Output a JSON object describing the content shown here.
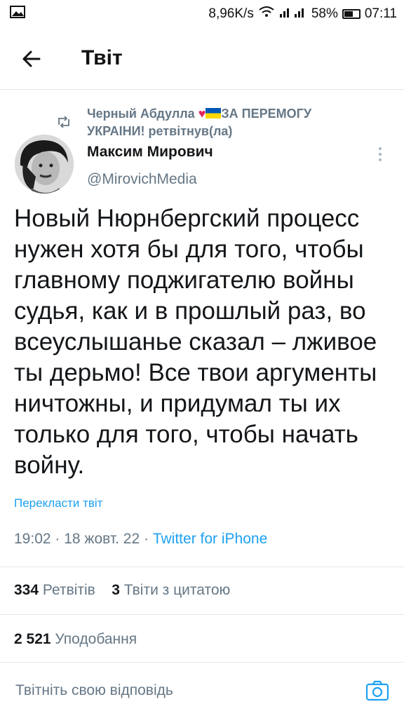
{
  "status_bar": {
    "speed": "8,96K/s",
    "battery": "58%",
    "time": "07:11"
  },
  "header": {
    "title": "Твіт"
  },
  "retweet": {
    "user": "Черный Абдулла",
    "suffix_a": "ЗА ПЕРЕМОГУ",
    "suffix_b": "УКРАІНИ! ретвітнув(ла)"
  },
  "author": {
    "name": "Максим Мирович",
    "handle": "@MirovichMedia"
  },
  "tweet": {
    "text": "Новый Нюрнбергский процесс нужен хотя бы для того, чтобы главному поджигателю войны судья, как и в прошлый раз, во всеуслышанье сказал – лживое ты дерьмо! Все твои аргументы ничтожны, и придумал ты их только для того, чтобы начать войну.",
    "translate": "Перекласти твіт",
    "time": "19:02",
    "date": "18 жовт. 22",
    "source": "Twitter for iPhone"
  },
  "stats": {
    "retweets_count": "334",
    "retweets_label": "Ретвітів",
    "quotes_count": "3",
    "quotes_label": "Твіти з цитатою",
    "likes_count": "2 521",
    "likes_label": "Уподобання"
  },
  "reply": {
    "placeholder": "Твітніть свою відповідь"
  },
  "colors": {
    "accent": "#1da1f2",
    "muted": "#657786",
    "text": "#14171a"
  },
  "icons": [
    "image-icon",
    "wifi-icon",
    "signal-icon",
    "battery-icon",
    "back-arrow-icon",
    "retweet-icon",
    "heart-icon",
    "ukraine-flag-icon",
    "more-vertical-icon",
    "camera-icon"
  ]
}
